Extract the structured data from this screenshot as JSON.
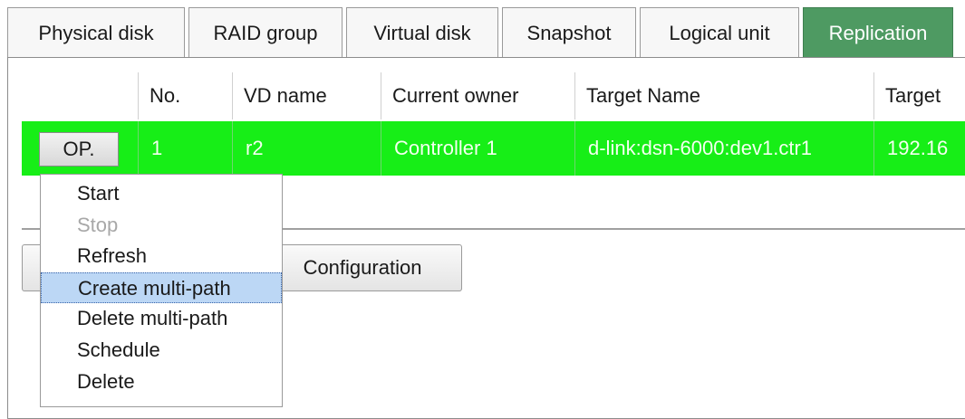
{
  "tabs": [
    {
      "label": "Physical disk"
    },
    {
      "label": "RAID group"
    },
    {
      "label": "Virtual disk"
    },
    {
      "label": "Snapshot"
    },
    {
      "label": "Logical unit"
    },
    {
      "label": "Replication",
      "active": true
    }
  ],
  "table": {
    "columns": [
      "",
      "No.",
      "VD name",
      "Current owner",
      "Target Name",
      "Target"
    ],
    "rows": [
      {
        "op": "OP.",
        "no": "1",
        "vd_name": "r2",
        "owner": "Controller 1",
        "target_name": "d-link:dsn-6000:dev1.ctr1",
        "target": "192.16"
      }
    ],
    "row_color": "#17ee17"
  },
  "menu": {
    "items": [
      {
        "label": "Start",
        "enabled": true
      },
      {
        "label": "Stop",
        "enabled": false
      },
      {
        "label": "Refresh",
        "enabled": true
      },
      {
        "label": "Create multi-path",
        "enabled": true,
        "highlighted": true
      },
      {
        "label": "Delete multi-path",
        "enabled": true
      },
      {
        "label": "Schedule",
        "enabled": true
      },
      {
        "label": "Delete",
        "enabled": true
      }
    ]
  },
  "buttons": {
    "configuration": "Configuration"
  },
  "colors": {
    "active_tab": "#4e9a62",
    "selected_row": "#17ee17",
    "menu_highlight": "#bcd7f5"
  }
}
